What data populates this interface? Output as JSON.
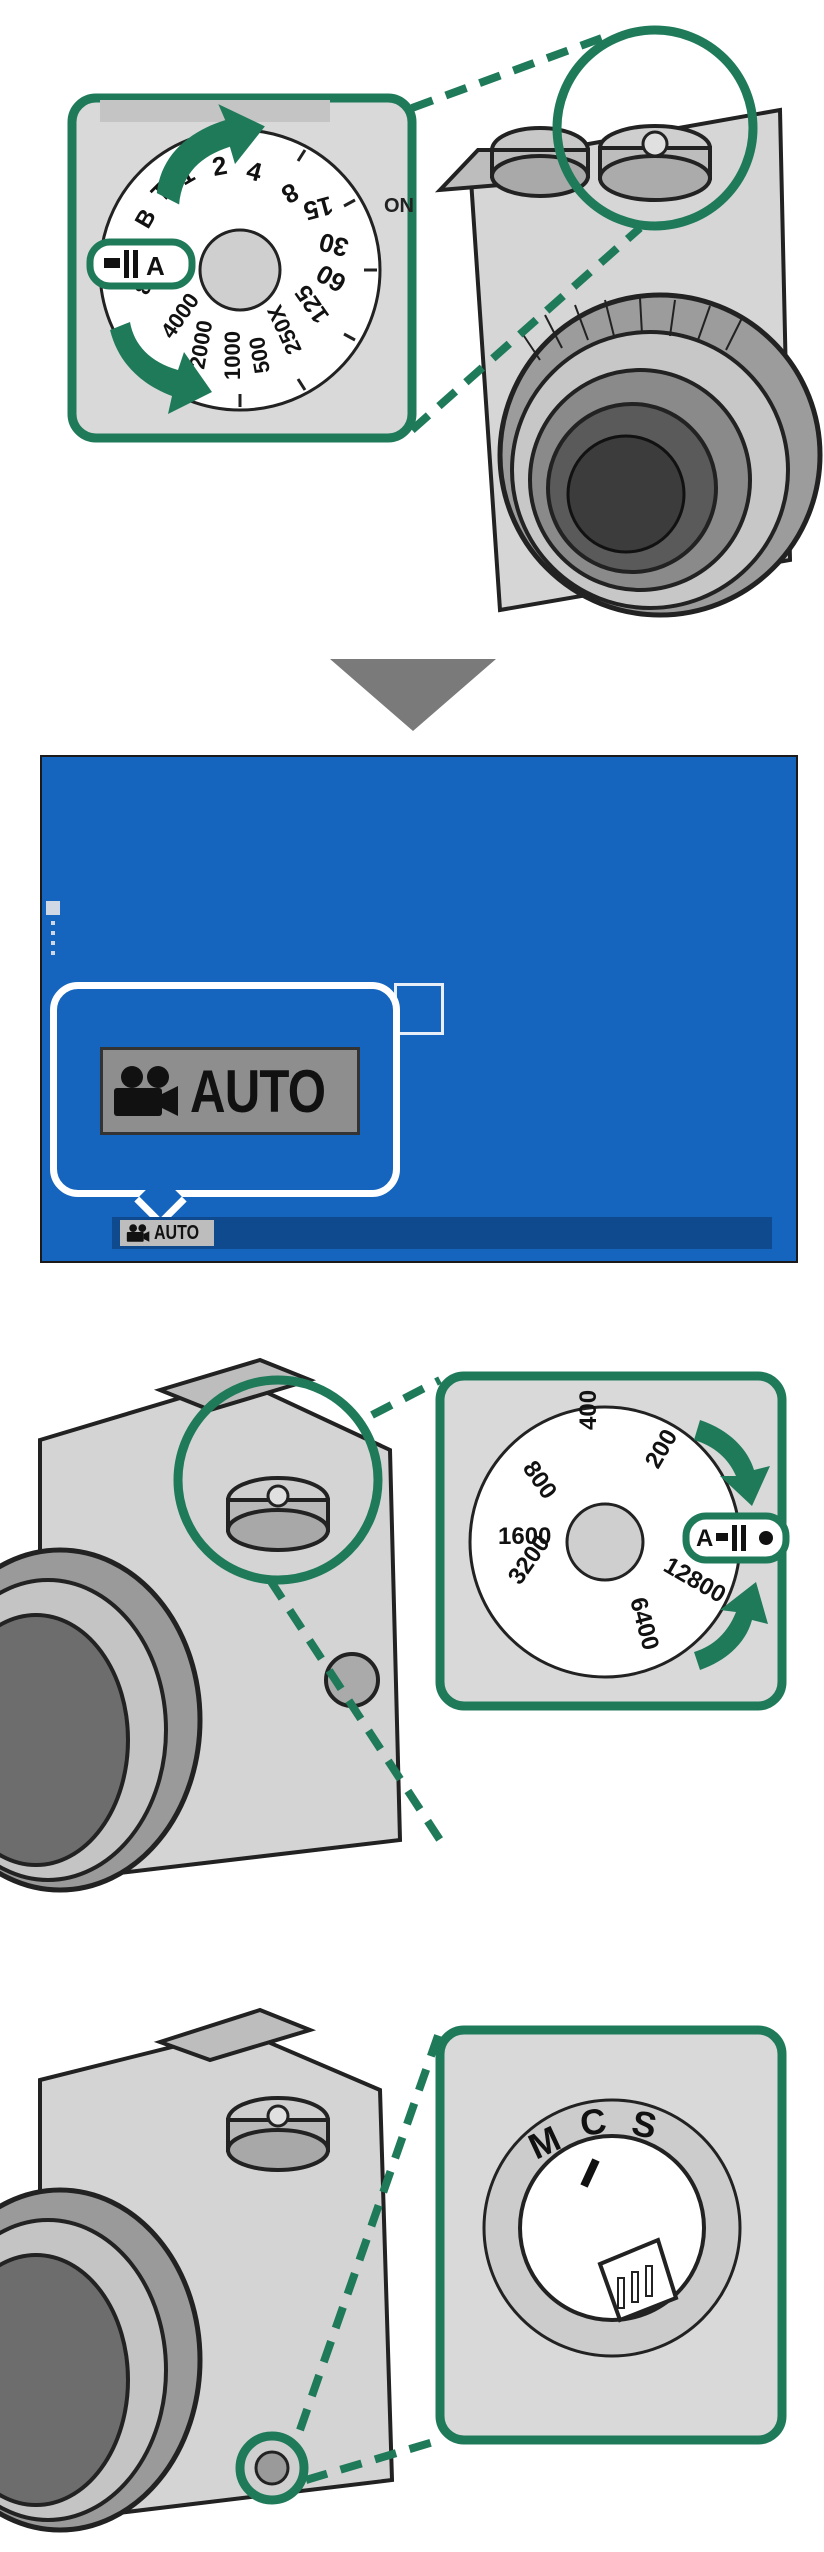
{
  "colors": {
    "accent_green": "#1f7a5a",
    "arrow_gray": "#7a7a7a",
    "screen_blue": "#1565be",
    "status_bar_blue": "#0f4a8e"
  },
  "shutter_dial": {
    "mode_label": "A",
    "speeds": [
      "4",
      "2",
      "1",
      "T",
      "B",
      "8000",
      "4000",
      "2000",
      "1000",
      "500",
      "250X",
      "125",
      "60",
      "30",
      "15",
      "8"
    ],
    "camera_on_label": "ON"
  },
  "screen": {
    "mode_badge_text": "AUTO",
    "status_text": "AUTO",
    "icon": "movie-camera-icon"
  },
  "iso_dial": {
    "mode_label": "A",
    "values": [
      "200",
      "400",
      "800",
      "1600",
      "3200",
      "6400",
      "12800"
    ]
  },
  "focus_selector": {
    "letters": [
      "M",
      "C",
      "S"
    ]
  }
}
